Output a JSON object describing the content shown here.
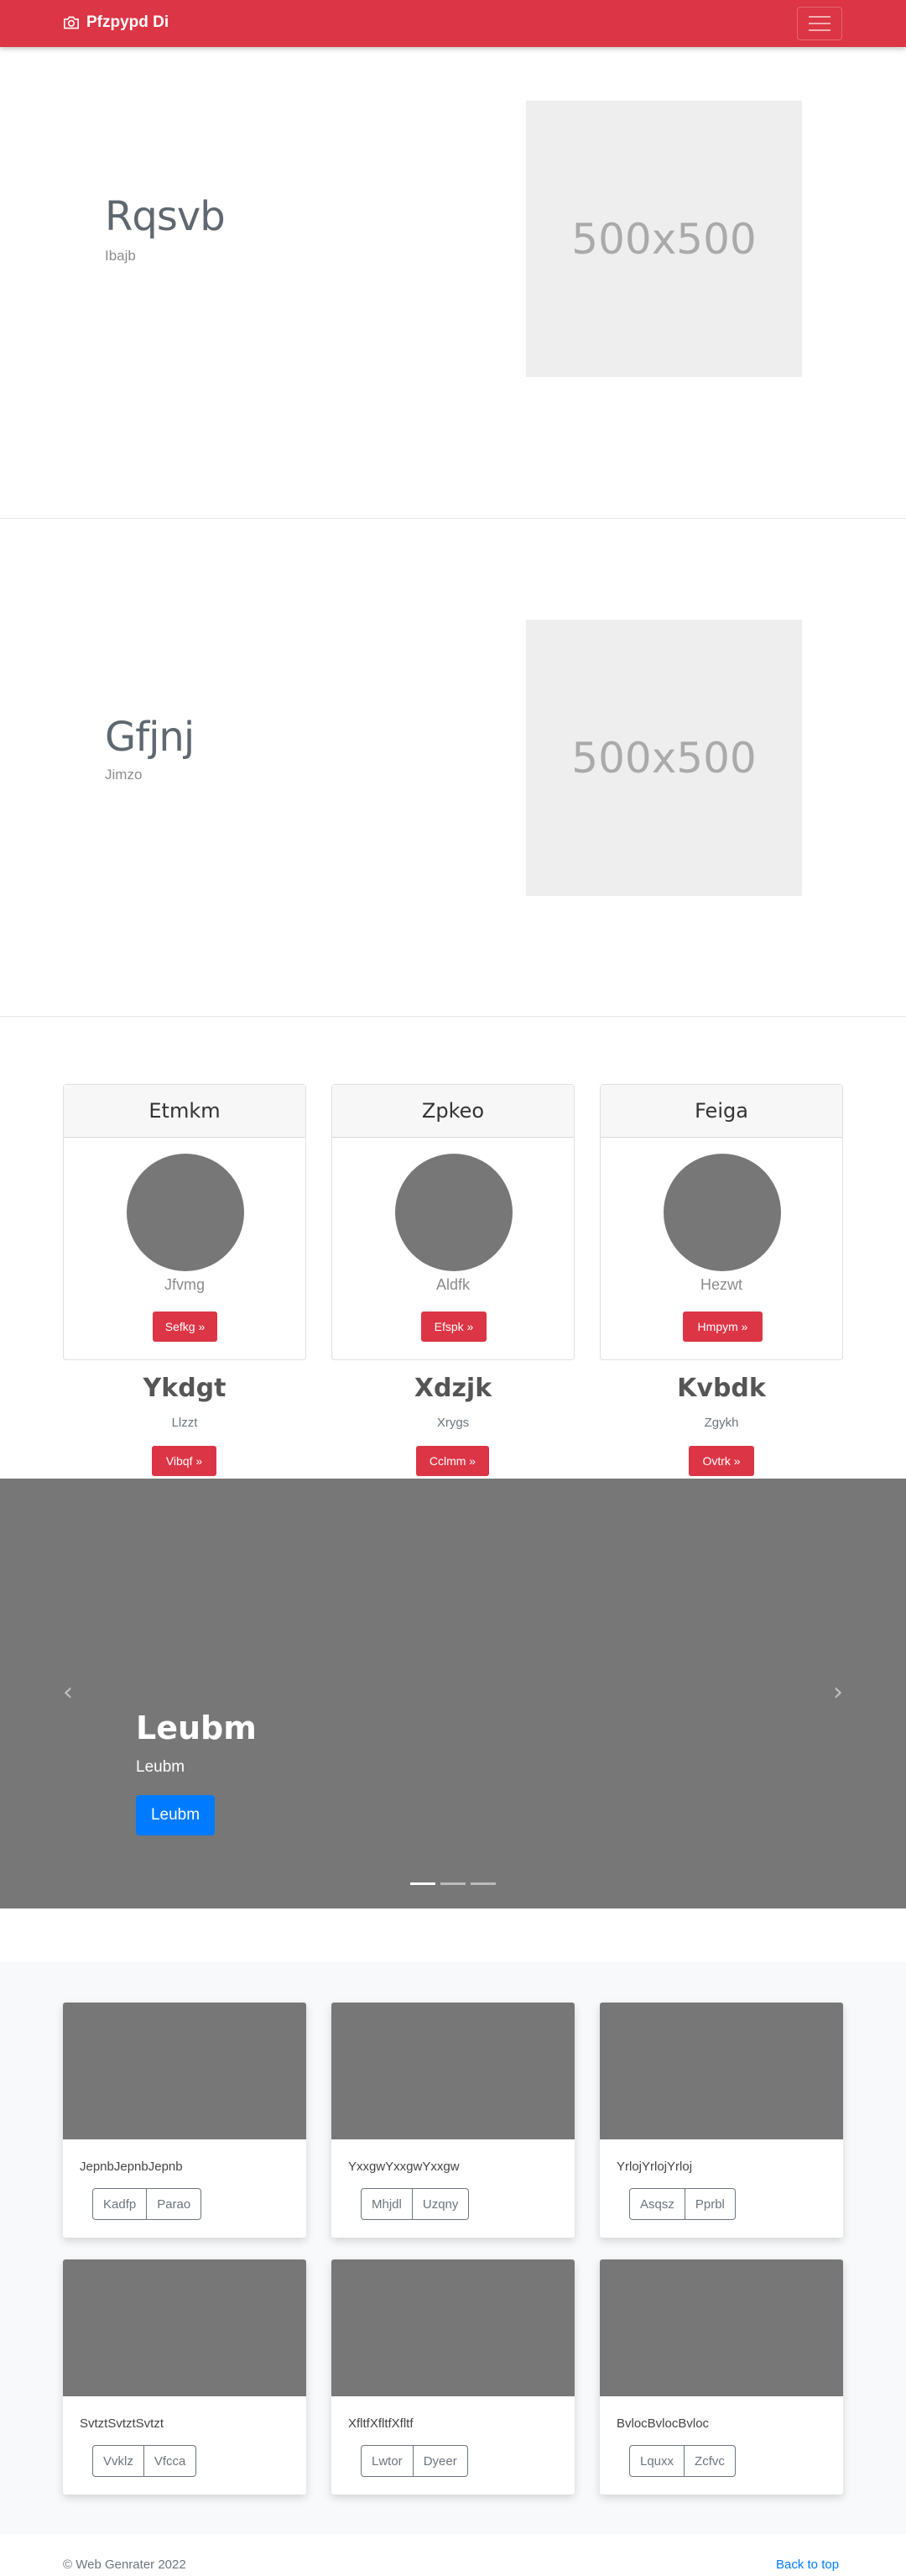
{
  "navbar": {
    "brand": "Pfzpypd Di",
    "brand_icon": "camera-icon"
  },
  "features": [
    {
      "heading": "Rqsvb",
      "sub": "Ibajb",
      "image_label": "500x500"
    },
    {
      "heading": "Gfjnj",
      "sub": "Jimzo",
      "image_label": "500x500"
    }
  ],
  "cards": [
    {
      "header": "Etmkm",
      "text": "Jfvmg",
      "button": "Sefkg »"
    },
    {
      "header": "Zpkeo",
      "text": "Aldfk",
      "button": "Efspk »"
    },
    {
      "header": "Feiga",
      "text": "Hezwt",
      "button": "Hmpym »"
    }
  ],
  "columns": [
    {
      "title": "Ykdgt",
      "sub": "Llzzt",
      "button": "Vibqf »"
    },
    {
      "title": "Xdzjk",
      "sub": "Xrygs",
      "button": "Cclmm »"
    },
    {
      "title": "Kvbdk",
      "sub": "Zgykh",
      "button": "Ovtrk »"
    }
  ],
  "carousel": {
    "title": "Leubm",
    "sub": "Leubm",
    "button": "Leubm",
    "prev": "‹",
    "next": "›",
    "indicators": 3,
    "active_indicator": 0
  },
  "album": [
    {
      "text": "JepnbJepnbJepnb",
      "btn1": "Kadfp",
      "btn2": "Parao"
    },
    {
      "text": "YxxgwYxxgwYxxgw",
      "btn1": "Mhjdl",
      "btn2": "Uzqny"
    },
    {
      "text": "YrlojYrlojYrloj",
      "btn1": "Asqsz",
      "btn2": "Pprbl"
    },
    {
      "text": "SvtztSvtztSvtzt",
      "btn1": "Vvklz",
      "btn2": "Vfcca"
    },
    {
      "text": "XfltfXfltfXfltf",
      "btn1": "Lwtor",
      "btn2": "Dyeer"
    },
    {
      "text": "BvlocBvlocBvloc",
      "btn1": "Lquxx",
      "btn2": "Zcfvc"
    }
  ],
  "footer": {
    "copyright": "© Web Genrater 2022",
    "back_to_top": "Back to top"
  },
  "colors": {
    "primary_red": "#dc3545",
    "primary_blue": "#007bff",
    "placeholder_gray": "#777777"
  }
}
